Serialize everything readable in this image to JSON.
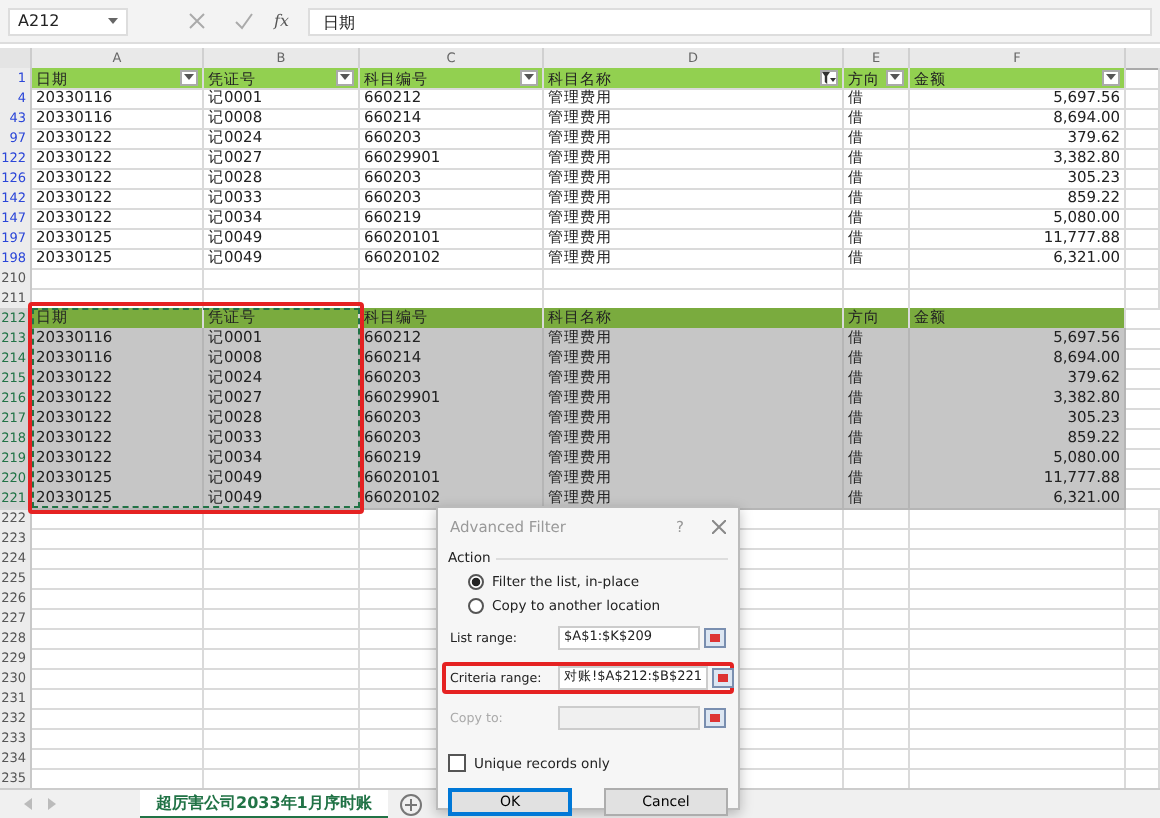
{
  "name_box": "A212",
  "formula_symbol": "fx",
  "formula": "日期",
  "columns": [
    "A",
    "B",
    "C",
    "D",
    "E",
    "F"
  ],
  "table": {
    "header_row": "1",
    "headers": [
      {
        "label": "日期",
        "filtered": false
      },
      {
        "label": "凭证号",
        "filtered": false
      },
      {
        "label": "科目编号",
        "filtered": false
      },
      {
        "label": "科目名称",
        "filtered": true
      },
      {
        "label": "方向",
        "filtered": false
      },
      {
        "label": "金额",
        "filtered": false
      }
    ],
    "rows": [
      {
        "row": "4",
        "cells": [
          "20330116",
          "记0001",
          "660212",
          "管理费用",
          "借",
          "5,697.56"
        ]
      },
      {
        "row": "43",
        "cells": [
          "20330116",
          "记0008",
          "660214",
          "管理费用",
          "借",
          "8,694.00"
        ]
      },
      {
        "row": "97",
        "cells": [
          "20330122",
          "记0024",
          "660203",
          "管理费用",
          "借",
          "379.62"
        ]
      },
      {
        "row": "122",
        "cells": [
          "20330122",
          "记0027",
          "66029901",
          "管理费用",
          "借",
          "3,382.80"
        ]
      },
      {
        "row": "126",
        "cells": [
          "20330122",
          "记0028",
          "660203",
          "管理费用",
          "借",
          "305.23"
        ]
      },
      {
        "row": "142",
        "cells": [
          "20330122",
          "记0033",
          "660203",
          "管理费用",
          "借",
          "859.22"
        ]
      },
      {
        "row": "147",
        "cells": [
          "20330122",
          "记0034",
          "660219",
          "管理费用",
          "借",
          "5,080.00"
        ]
      },
      {
        "row": "197",
        "cells": [
          "20330125",
          "记0049",
          "66020101",
          "管理费用",
          "借",
          "11,777.88"
        ]
      },
      {
        "row": "198",
        "cells": [
          "20330125",
          "记0049",
          "66020102",
          "管理费用",
          "借",
          "6,321.00"
        ]
      }
    ]
  },
  "gap_rows": [
    "210",
    "211"
  ],
  "criteria": {
    "selected": true,
    "header_row": "212",
    "headers": [
      "日期",
      "凭证号",
      "科目编号",
      "科目名称",
      "方向",
      "金额"
    ],
    "rows": [
      {
        "row": "213",
        "cells": [
          "20330116",
          "记0001",
          "660212",
          "管理费用",
          "借",
          "5,697.56"
        ]
      },
      {
        "row": "214",
        "cells": [
          "20330116",
          "记0008",
          "660214",
          "管理费用",
          "借",
          "8,694.00"
        ]
      },
      {
        "row": "215",
        "cells": [
          "20330122",
          "记0024",
          "660203",
          "管理费用",
          "借",
          "379.62"
        ]
      },
      {
        "row": "216",
        "cells": [
          "20330122",
          "记0027",
          "66029901",
          "管理费用",
          "借",
          "3,382.80"
        ]
      },
      {
        "row": "217",
        "cells": [
          "20330122",
          "记0028",
          "660203",
          "管理费用",
          "借",
          "305.23"
        ]
      },
      {
        "row": "218",
        "cells": [
          "20330122",
          "记0033",
          "660203",
          "管理费用",
          "借",
          "859.22"
        ]
      },
      {
        "row": "219",
        "cells": [
          "20330122",
          "记0034",
          "660219",
          "管理费用",
          "借",
          "5,080.00"
        ]
      },
      {
        "row": "220",
        "cells": [
          "20330125",
          "记0049",
          "66020101",
          "管理费用",
          "借",
          "11,777.88"
        ]
      },
      {
        "row": "221",
        "cells": [
          "20330125",
          "记0049",
          "66020102",
          "管理费用",
          "借",
          "6,321.00"
        ]
      }
    ]
  },
  "trailing_rows": [
    "222",
    "223",
    "224",
    "225",
    "226",
    "227",
    "228",
    "229",
    "230",
    "231",
    "232",
    "233",
    "234",
    "235"
  ],
  "sheet_tabs": [
    {
      "label": "超厉害公司2033年1月序时账",
      "selected": true
    }
  ],
  "dialog": {
    "title": "Advanced Filter",
    "help": "?",
    "action_label": "Action",
    "options": [
      {
        "label": "Filter the list, in-place",
        "selected": true
      },
      {
        "label": "Copy to another location",
        "selected": false
      }
    ],
    "fields": [
      {
        "label": "List range:",
        "value": "$A$1:$K$209",
        "disabled": false,
        "highlighted": false
      },
      {
        "label": "Criteria range:",
        "value": "对账!$A$212:$B$221",
        "disabled": false,
        "highlighted": true
      },
      {
        "label": "Copy to:",
        "disabled": true,
        "highlighted": false
      }
    ],
    "unique": {
      "label": "Unique records only",
      "checked": false
    },
    "buttons": [
      "OK",
      "Cancel"
    ]
  }
}
